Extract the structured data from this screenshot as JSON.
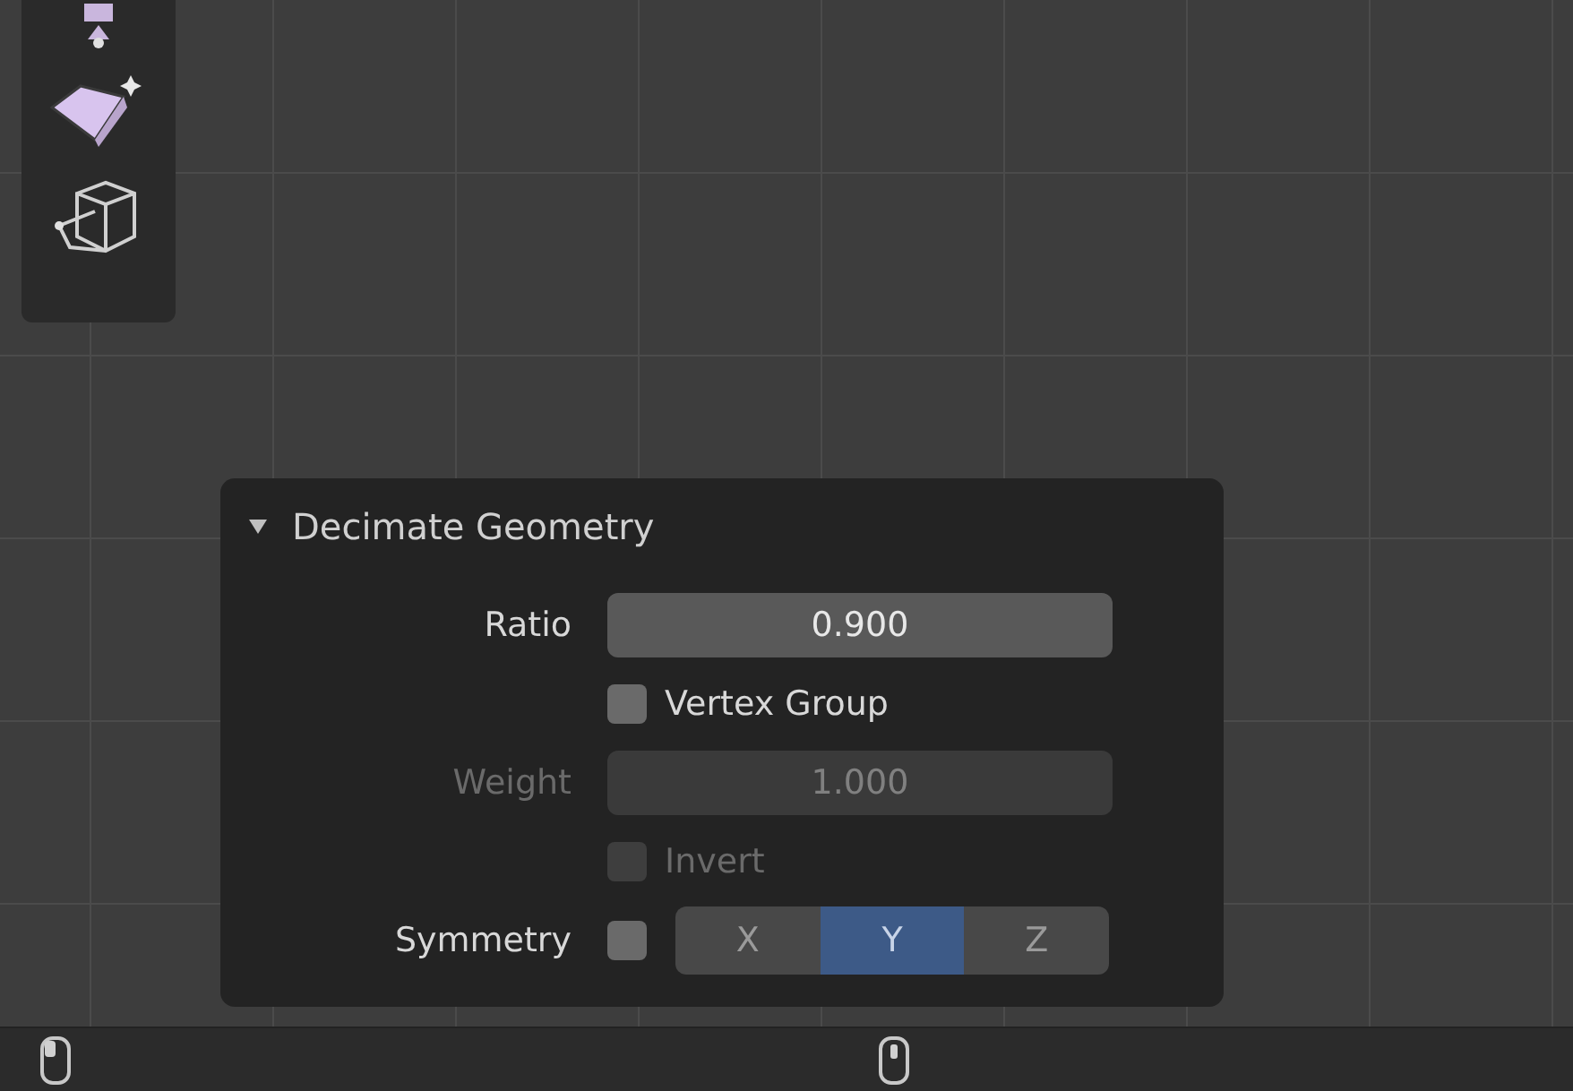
{
  "panel": {
    "title": "Decimate Geometry",
    "expanded": true,
    "rows": [
      {
        "kind": "number",
        "label": "Ratio",
        "value": "0.900",
        "disabled": false
      },
      {
        "kind": "checkbox",
        "label": "Vertex Group",
        "checked": false,
        "disabled": false
      },
      {
        "kind": "number",
        "label": "Weight",
        "value": "1.000",
        "disabled": true
      },
      {
        "kind": "checkbox",
        "label": "Invert",
        "checked": false,
        "disabled": true
      },
      {
        "kind": "symmetry",
        "label": "Symmetry",
        "checked": false,
        "axes": [
          {
            "label": "X",
            "selected": false
          },
          {
            "label": "Y",
            "selected": true
          },
          {
            "label": "Z",
            "selected": false
          }
        ]
      }
    ]
  }
}
